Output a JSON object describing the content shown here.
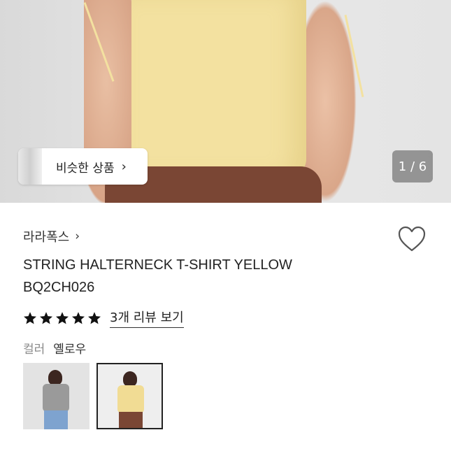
{
  "gallery": {
    "similar_label": "비슷한 상품",
    "counter": "1 / 6"
  },
  "product": {
    "brand": "라라폭스",
    "title_line1": "STRING HALTERNECK T-SHIRT YELLOW",
    "title_line2": "BQ2CH026",
    "rating_stars": 5,
    "review_link": "3개 리뷰 보기",
    "color_label": "컬러",
    "color_value": "옐로우"
  },
  "colors": {
    "top_yellow": "#f3e1a0",
    "skirt_brown": "#7a4634",
    "counter_bg": "#7a7a7a",
    "star": "#111111"
  },
  "variants": [
    {
      "name": "gray",
      "selected": false
    },
    {
      "name": "yellow",
      "selected": true
    }
  ]
}
